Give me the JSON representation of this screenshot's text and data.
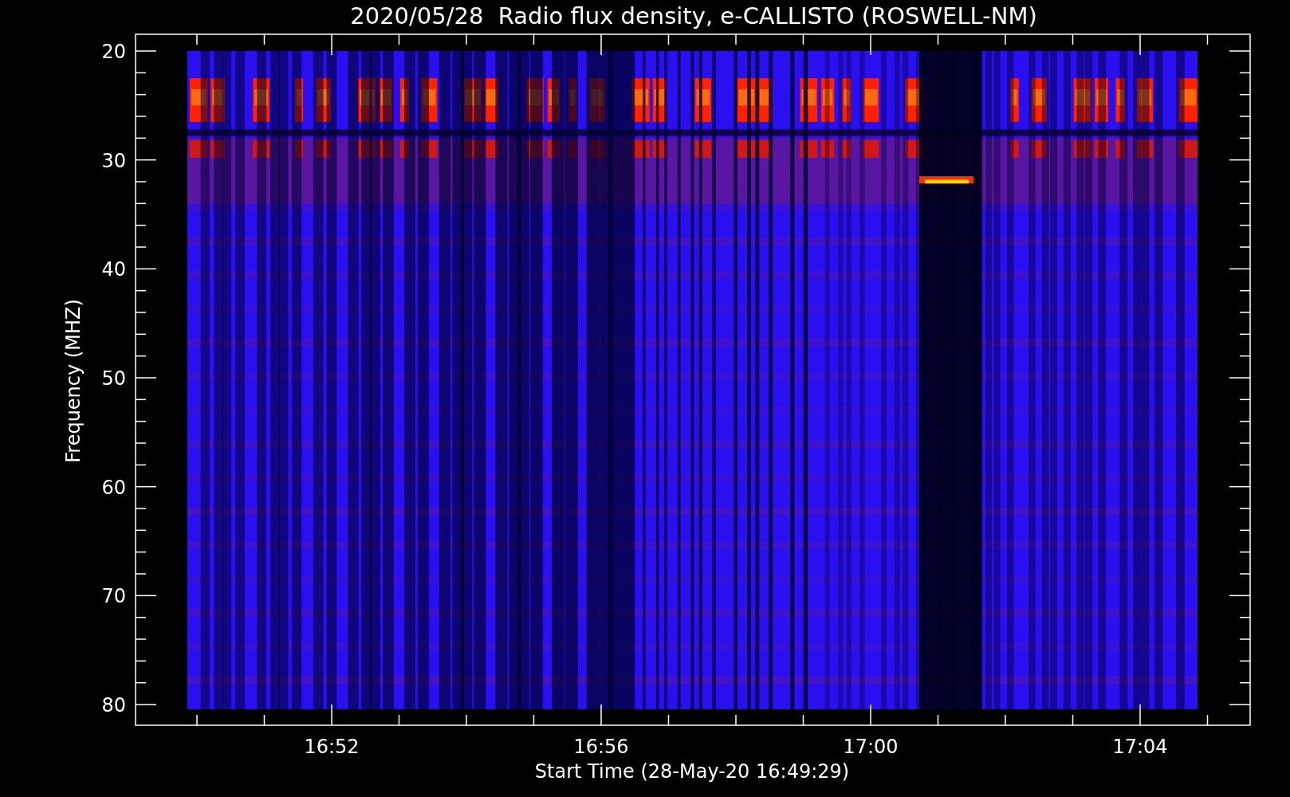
{
  "plot": {
    "title": "2020/05/28  Radio flux density, e-CALLISTO (ROSWELL-NM)",
    "y_axis": {
      "label": "Frequency (MHZ)",
      "ticks": [
        "20",
        "30",
        "40",
        "50",
        "60",
        "70",
        "80"
      ]
    },
    "x_axis": {
      "label": "Start Time (28-May-20 16:49:29)",
      "ticks": [
        "16:52",
        "16:56",
        "17:00",
        "17:04"
      ]
    }
  }
}
